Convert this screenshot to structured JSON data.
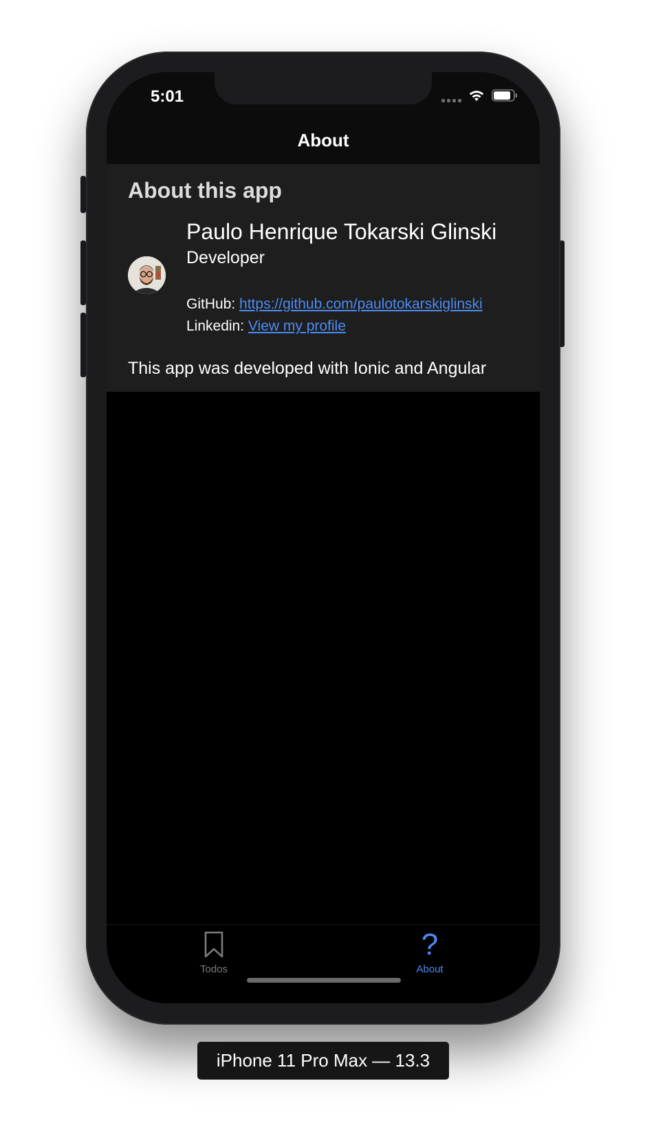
{
  "status_bar": {
    "time": "5:01",
    "icons": [
      "signal-icon",
      "wifi-icon",
      "battery-icon"
    ]
  },
  "nav": {
    "title": "About"
  },
  "card": {
    "title": "About this app",
    "developer_name": "Paulo Henrique Tokarski Glinski",
    "developer_role": "Developer",
    "github_label": "GitHub:",
    "github_link": "https://github.com/paulotokarskiglinski",
    "linkedin_label": "Linkedin:",
    "linkedin_link": "View my profile",
    "description": "This app was developed with Ionic and Angular"
  },
  "tabs": [
    {
      "label": "Todos",
      "icon": "bookmark-icon",
      "active": false
    },
    {
      "label": "About",
      "icon": "question-icon",
      "active": true
    }
  ],
  "device_label": "iPhone 11 Pro Max — 13.3",
  "colors": {
    "accent": "#4d8bf5",
    "background": "#000000",
    "card_background": "#1e1e1e",
    "inactive_tab": "#7b7b7b"
  }
}
